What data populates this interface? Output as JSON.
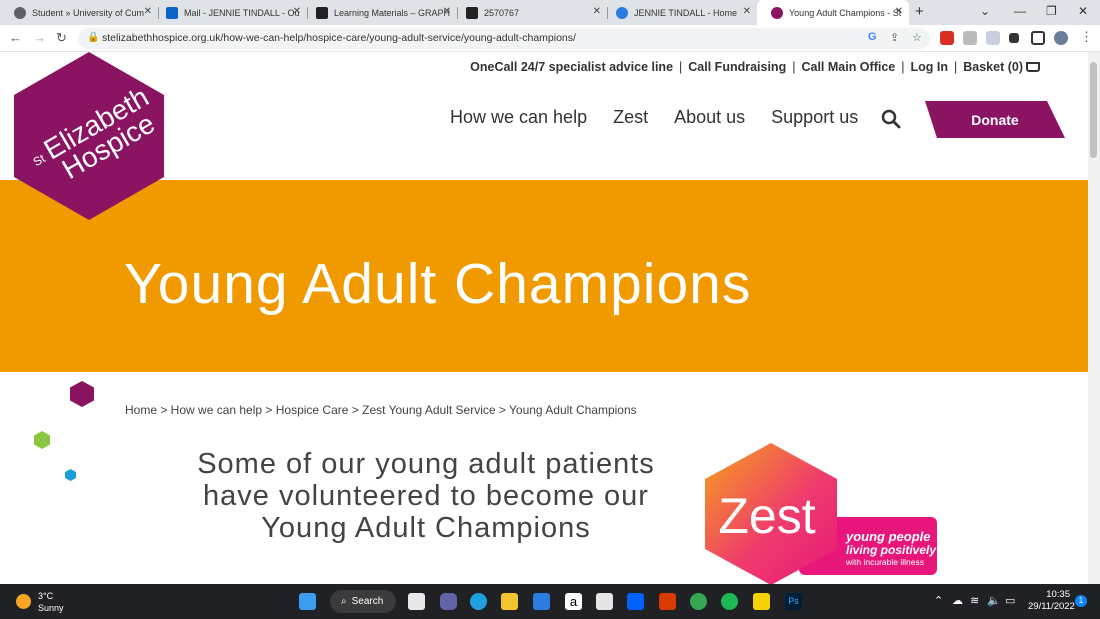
{
  "browser": {
    "tabs": [
      {
        "label": "Student » University of Cum",
        "icon": "globe-icon",
        "color": "#5f6368"
      },
      {
        "label": "Mail - JENNIE TINDALL - Ou",
        "icon": "outlook-icon",
        "color": "#0a64c8"
      },
      {
        "label": "Learning Materials – GRAPH",
        "icon": "blackboard-icon",
        "color": "#222222"
      },
      {
        "label": "2570767",
        "icon": "blackboard-icon",
        "color": "#222222"
      },
      {
        "label": "JENNIE TINDALL - Home",
        "icon": "onedrive-icon",
        "color": "#2a7de1"
      },
      {
        "label": "Young Adult Champions - St",
        "icon": "hospice-icon",
        "color": "#8a1462"
      }
    ],
    "url": "stelizabethhospice.org.uk/how-we-can-help/hospice-care/young-adult-service/young-adult-champions/"
  },
  "site": {
    "utility_links": [
      "OneCall 24/7 specialist advice line",
      "Call Fundraising",
      "Call Main Office",
      "Log In",
      "Basket (0)"
    ],
    "logo_text": {
      "prefix": "St",
      "line1": "Elizabeth",
      "line2": "Hospice"
    },
    "nav": [
      "How we can help",
      "Zest",
      "About us",
      "Support us"
    ],
    "donate_label": "Donate",
    "banner_title": "Young Adult Champions",
    "breadcrumb": "Home > How we can help > Hospice Care > Zest Young Adult Service > Young Adult Champions",
    "intro_lines": [
      "Some of our young adult patients",
      "have volunteered to become our",
      "Young Adult Champions"
    ],
    "zest_logo": {
      "word": "Zest",
      "tag1": "young people",
      "tag2": "living positively",
      "tag3": "with incurable illness"
    },
    "colors": {
      "brand_purple": "#8a1462",
      "banner_orange": "#f09a00",
      "accent_green": "#8dc63f",
      "accent_blue": "#1b9fd6"
    }
  },
  "taskbar": {
    "temperature": "3°C",
    "weather": "Sunny",
    "search_label": "Search",
    "time": "10:35",
    "date": "29/11/2022",
    "notification_count": "1"
  }
}
